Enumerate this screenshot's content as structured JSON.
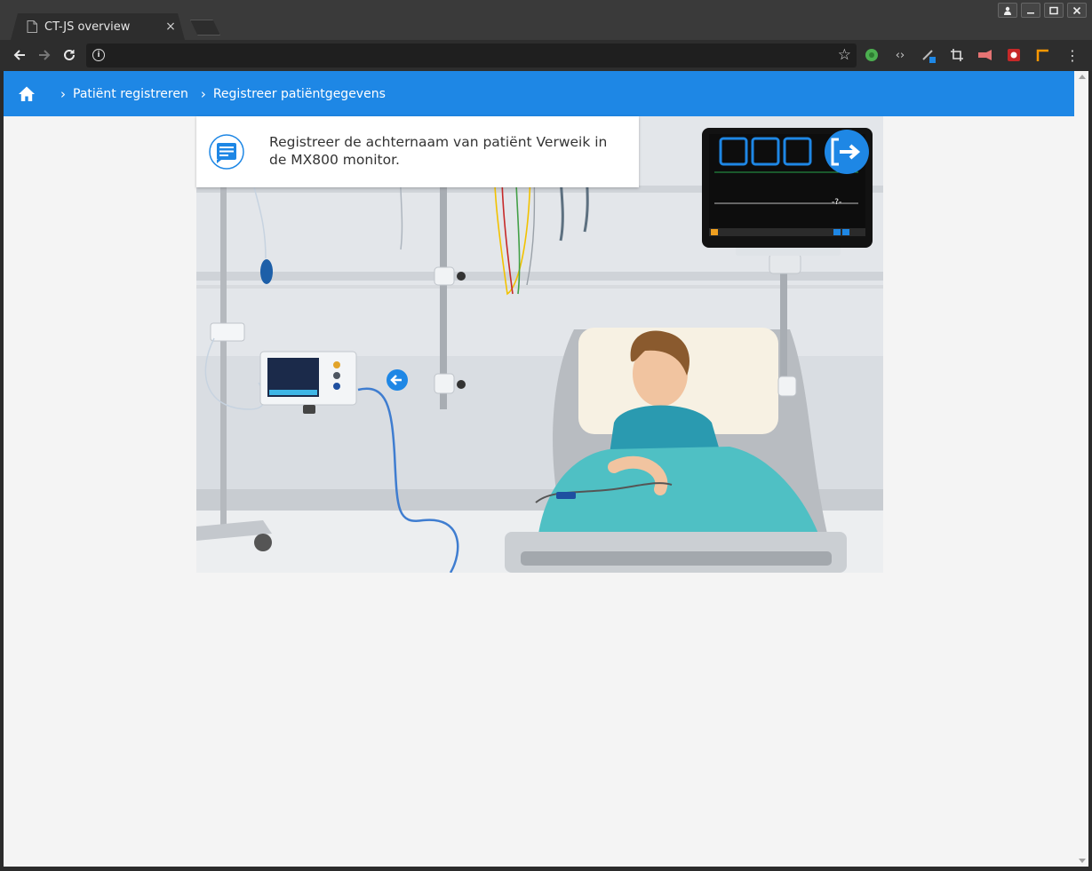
{
  "browser": {
    "tab_title": "CT-JS overview",
    "tab_close": "×",
    "url": "",
    "window_buttons": [
      "person-icon",
      "minimize-icon",
      "maximize-icon",
      "close-icon"
    ]
  },
  "app": {
    "header_color": "#1e87e5",
    "breadcrumb": [
      {
        "label": "Patiënt registreren"
      },
      {
        "label": "Registreer patiëntgegevens"
      }
    ]
  },
  "instruction": {
    "text": "Registreer de achternaam van patiënt Verweik in de MX800 monitor."
  },
  "monitor": {
    "readout": "-?-"
  }
}
